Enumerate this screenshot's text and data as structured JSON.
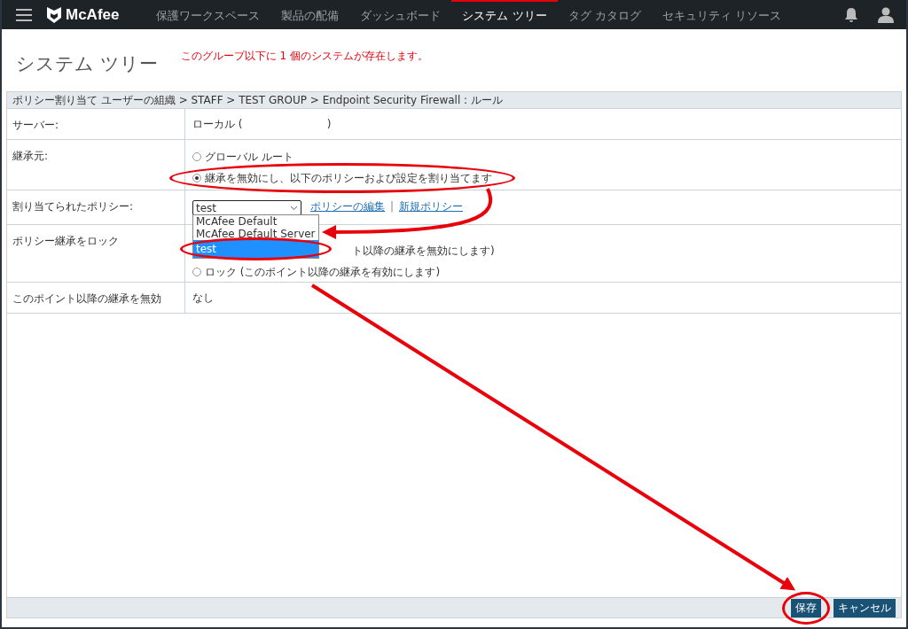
{
  "header": {
    "brand": "McAfee",
    "nav": [
      {
        "label": "保護ワークスペース",
        "selected": false
      },
      {
        "label": "製品の配備",
        "selected": false
      },
      {
        "label": "ダッシュボード",
        "selected": false
      },
      {
        "label": "システム ツリー",
        "selected": true
      },
      {
        "label": "タグ カタログ",
        "selected": false
      },
      {
        "label": "セキュリティ リソース",
        "selected": false
      }
    ]
  },
  "page": {
    "title": "システム ツリー",
    "message": "このグループ以下に 1 個のシステムが存在します。"
  },
  "breadcrumb": "ポリシー割り当て ユーザーの組織 > STAFF > TEST GROUP > Endpoint Security Firewall : ルール",
  "rows": [
    {
      "kind": "text",
      "label": "サーバー:",
      "value": "ローカル (                         )"
    },
    {
      "kind": "radio",
      "label": "継承元:",
      "options": [
        {
          "kind": "radio",
          "label": "グローバル ルート",
          "selected": false
        },
        {
          "kind": "radio",
          "label": "継承を無効にし、以下のポリシーおよび設定を割り当てます",
          "selected": true
        }
      ]
    },
    {
      "kind": "select",
      "label": "割り当てられたポリシー:",
      "value": "test",
      "expanded": true,
      "options": [
        {
          "label": "McAfee Default",
          "selected": false
        },
        {
          "label": "McAfee Default Server",
          "selected": false
        },
        {
          "label": "test",
          "selected": true
        }
      ],
      "links": [
        "ポリシーの編集",
        "新規ポリシー"
      ],
      "separator": "|"
    },
    {
      "kind": "radio",
      "label": "ポリシー継承をロック",
      "options": [
        {
          "kind": "partial",
          "label": "ト以降の継承を無効にします)"
        },
        {
          "kind": "radio",
          "label": "ロック (このポイント以降の継承を有効にします)",
          "selected": false
        }
      ]
    },
    {
      "kind": "text",
      "label": "このポイント以降の継承を無効",
      "value": "なし"
    }
  ],
  "buttons": [
    "保存",
    "キャンセル"
  ]
}
